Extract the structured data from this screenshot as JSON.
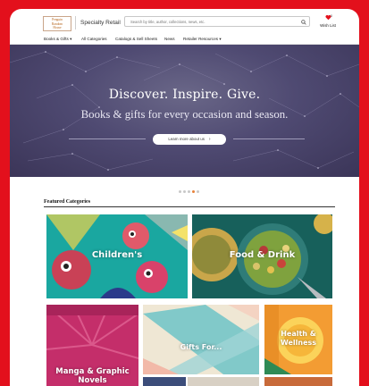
{
  "header": {
    "logo_lines": [
      "Penguin",
      "Random",
      "House"
    ],
    "brand": "Specialty Retail",
    "search_placeholder": "Search by title, author, collections, news, etc.",
    "wishlist_label": "Wish List",
    "wishlist_count": "0"
  },
  "nav": {
    "items": [
      {
        "label": "Books & Gifts ▾"
      },
      {
        "label": "All Categories"
      },
      {
        "label": "Catalogs & Sell Sheets"
      },
      {
        "label": "News"
      },
      {
        "label": "Retailer Resources ▾"
      }
    ]
  },
  "hero": {
    "title": "Discover. Inspire. Give.",
    "subtitle": "Books & gifts for every occasion and season.",
    "button_label": "Learn more about us",
    "slide_count": 5,
    "active_slide": 4
  },
  "featured": {
    "title": "Featured Categories",
    "tiles": [
      {
        "label": "Children's"
      },
      {
        "label": "Food & Drink"
      },
      {
        "label": "Manga & Graphic Novels"
      },
      {
        "label": "Gifts For..."
      },
      {
        "label": "Health & Wellness"
      }
    ]
  },
  "colors": {
    "page_background": "#e3101c",
    "hero_background": "#4f4a72",
    "active_dot": "#e8823a",
    "wishlist_heart": "#e3101c"
  },
  "icons": [
    "search-icon",
    "heart-icon",
    "chevron-right-icon",
    "chevron-down-icon"
  ]
}
